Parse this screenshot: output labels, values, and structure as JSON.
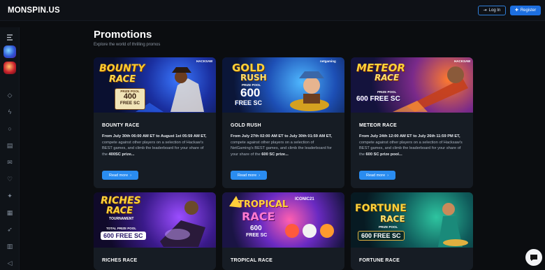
{
  "header": {
    "logo": "MONSPIN.US",
    "login_label": "Log In",
    "register_label": "Register"
  },
  "sidebar": {
    "icons": [
      "menu-toggle-icon",
      "avatar-blue",
      "avatar-red",
      "diamond-icon",
      "lightning-icon",
      "circle-icon",
      "gift-icon",
      "mail-icon",
      "heart-icon",
      "sparkle-icon",
      "grid-icon",
      "rocket-icon",
      "chart-icon",
      "megaphone-icon"
    ]
  },
  "page": {
    "title": "Promotions",
    "subtitle": "Explore the world of thrilling promos"
  },
  "promos": [
    {
      "title": "BOUNTY RACE",
      "desc_a": "From July 30th 06:00 AM ET to August 1st 05:59 AM ET,",
      "desc_b": " compete against other players on a selection of Hackaw's BEST games, and climb the leaderboard for your share of the ",
      "desc_c": "400SC prize...",
      "read_more": "Read more",
      "banner_line1": "BOUNTY",
      "banner_line2": "RACE",
      "banner_pool": "PRIZE POOL",
      "banner_amount": "400",
      "banner_unit": "FREE SC",
      "provider": "HACKSAW"
    },
    {
      "title": "GOLD RUSH",
      "desc_a": "From July 27th 02:00 AM ET to July 30th 01:59 AM ET,",
      "desc_b": " compete against other players on a selection of NetGaming's BEST games, and climb the leaderboard for your share of the ",
      "desc_c": "600 SC prize...",
      "read_more": "Read more",
      "banner_line1": "GOLD",
      "banner_line2": "RUSH",
      "banner_pool": "PRIZE POOL",
      "banner_amount": "600",
      "banner_unit": "FREE SC",
      "provider": "netgaming"
    },
    {
      "title": "METEOR RACE",
      "desc_a": "From July 24th 12:00 AM ET to July 26th 11:59 PM ET,",
      "desc_b": " compete against other players on a selection of Hacksaw's BEST games, and climb the leaderboard for your share of the ",
      "desc_c": "600 SC prize pool...",
      "read_more": "Read more",
      "banner_line1": "METEOR",
      "banner_line2": "RACE",
      "banner_pool": "PRIZE POOL",
      "banner_amount": "600 FREE SC",
      "provider": "HACKSAW"
    },
    {
      "title": "RICHES RACE",
      "banner_line1": "RICHES",
      "banner_line2": "RACE",
      "banner_pool": "TOURNAMENT",
      "banner_pool2": "TOTAL PRIZE POOL",
      "banner_amount": "600 FREE SC"
    },
    {
      "title": "TROPICAL RACE",
      "banner_line1": "TROPICAL",
      "banner_line2": "RACE",
      "banner_amount": "600",
      "banner_unit": "FREE SC",
      "provider": "ICONIC21"
    },
    {
      "title": "FORTUNE RACE",
      "banner_line1": "FORTUNE",
      "banner_line2": "RACE",
      "banner_pool": "PRIZE POOL",
      "banner_amount": "600 FREE SC"
    }
  ],
  "colors": {
    "accent": "#2a8cf0",
    "card_bg": "#161c24",
    "page_bg": "#0b0d10"
  }
}
